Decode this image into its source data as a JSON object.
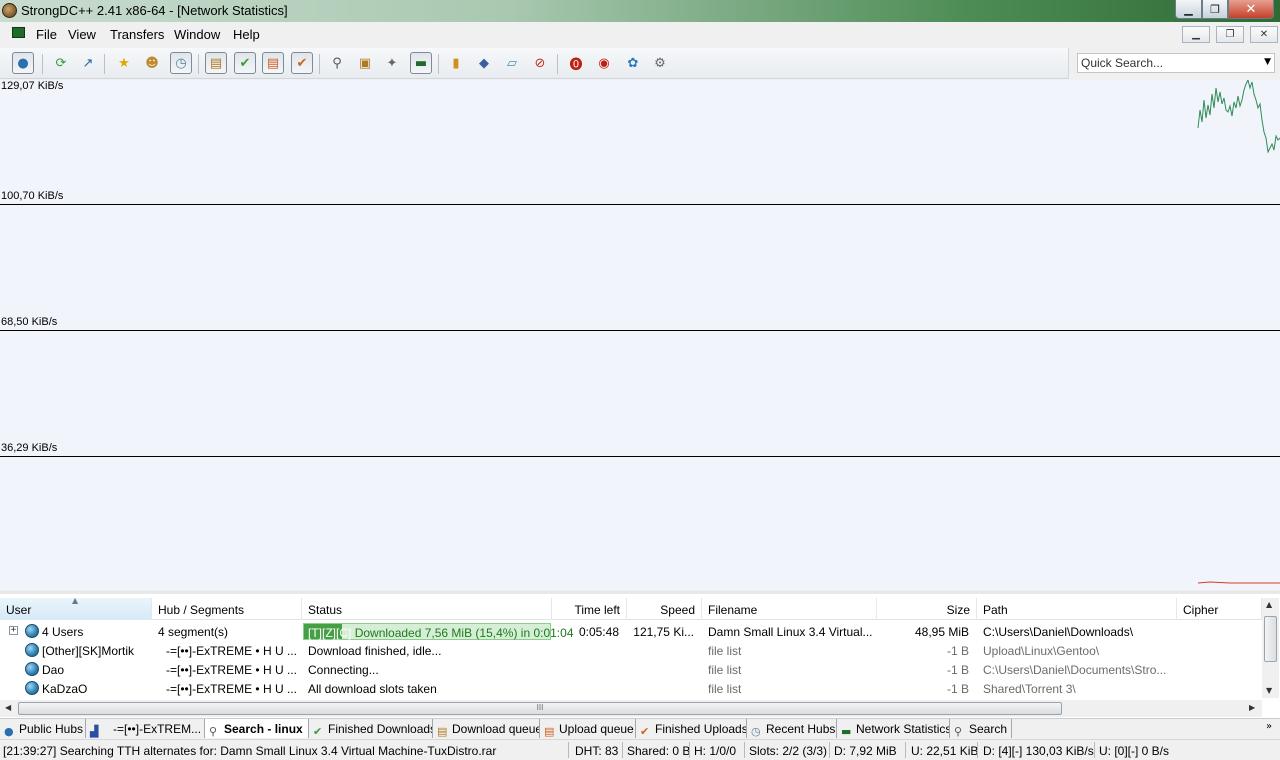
{
  "window": {
    "title": "StrongDC++ 2.41 x86-64 - [Network Statistics]"
  },
  "menu": [
    "File",
    "View",
    "Transfers",
    "Window",
    "Help"
  ],
  "toolbar_icons": [
    "public-hubs-icon",
    "reconnect-icon",
    "follow-redirect-icon",
    "favorite-hubs-icon",
    "favorite-users-icon",
    "recent-hubs-icon",
    "download-queue-icon",
    "finished-downloads-icon",
    "upload-queue-icon",
    "finished-uploads-icon",
    "search-icon",
    "adl-search-icon",
    "search-spy-icon",
    "network-statistics-icon",
    "notepad-icon",
    "system-log-icon",
    "open-file-list-icon",
    "refresh-share-icon",
    "away-icon",
    "limiter-icon",
    "cdm-debug-icon",
    "settings-icon"
  ],
  "quick_search": {
    "placeholder": "Quick Search..."
  },
  "graph": {
    "labels": [
      "129,07 KiB/s",
      "100,70 KiB/s",
      "68,50 KiB/s",
      "36,29 KiB/s"
    ],
    "download_color": "#2e8b57",
    "upload_color": "#d04020"
  },
  "transfers": {
    "columns": [
      "User",
      "Hub / Segments",
      "Status",
      "Time left",
      "Speed",
      "Filename",
      "Size",
      "Path",
      "Cipher"
    ],
    "rows": [
      {
        "user": "4 Users",
        "hub": "4 segment(s)",
        "status_segments": "[T][Z][C]",
        "status": "Downloaded 7,56 MiB (15,4%) in 0:01:04",
        "progress": 0.154,
        "time_left": "0:05:48",
        "speed": "121,75 Ki...",
        "filename": "Damn Small Linux 3.4 Virtual...",
        "size": "48,95 MiB",
        "path": "C:\\Users\\Daniel\\Downloads\\",
        "cipher": ""
      },
      {
        "user": "[Other][SK]Mortik",
        "hub": "-=[••]-ExTREME • H U ...",
        "status": "Download finished, idle...",
        "time_left": "",
        "speed": "",
        "filename": "file list",
        "size": "-1 B",
        "path": "Upload\\Linux\\Gentoo\\",
        "cipher": ""
      },
      {
        "user": "Dao",
        "hub": "-=[••]-ExTREME • H U ...",
        "status": "Connecting...",
        "time_left": "",
        "speed": "",
        "filename": "file list",
        "size": "-1 B",
        "path": "C:\\Users\\Daniel\\Documents\\Stro...",
        "cipher": ""
      },
      {
        "user": "KaDzaO",
        "hub": "-=[••]-ExTREME • H U ...",
        "status": "All download slots taken",
        "time_left": "",
        "speed": "",
        "filename": "file list",
        "size": "-1 B",
        "path": "Shared\\Torrent 3\\",
        "cipher": ""
      }
    ]
  },
  "tabs": [
    {
      "label": "Public Hubs",
      "icon": "globe-icon"
    },
    {
      "label": "-=[••]-ExTREM...",
      "icon": "hub-icon"
    },
    {
      "label": "Search - linux",
      "icon": "search-icon",
      "active": true
    },
    {
      "label": "Finished Downloads",
      "icon": "check-icon"
    },
    {
      "label": "Download queue",
      "icon": "queue-icon"
    },
    {
      "label": "Upload queue",
      "icon": "upload-icon"
    },
    {
      "label": "Finished Uploads",
      "icon": "check-icon"
    },
    {
      "label": "Recent Hubs",
      "icon": "clock-icon"
    },
    {
      "label": "Network Statistics",
      "icon": "monitor-icon"
    },
    {
      "label": "Search",
      "icon": "search-icon"
    }
  ],
  "status": {
    "log": "[21:39:27] Searching TTH alternates for: Damn Small Linux 3.4 Virtual Machine-TuxDistro.rar",
    "dht": "DHT: 83",
    "shared": "Shared: 0 B",
    "hubs": "H: 1/0/0",
    "slots": "Slots: 2/2 (3/3)",
    "downloaded": "D: 7,92 MiB",
    "uploaded": "U: 22,51 KiB",
    "down_speed": "D: [4][-] 130,03 KiB/s",
    "up_speed": "U: [0][-] 0 B/s"
  }
}
